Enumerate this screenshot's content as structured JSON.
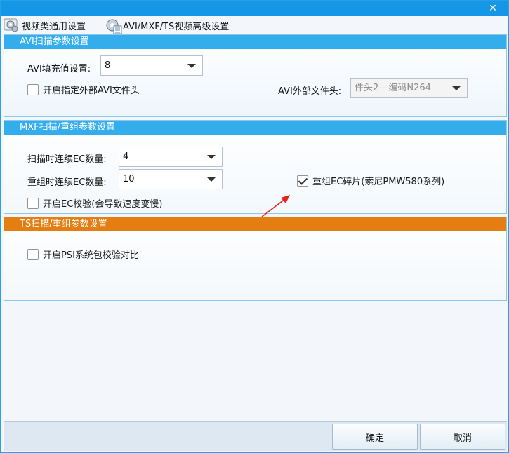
{
  "window": {
    "close_glyph": "✕"
  },
  "tabs": [
    {
      "label": "视频类通用设置",
      "icon": "gear-gray-icon"
    },
    {
      "label": "AVI/MXF/TS视频高级设置",
      "icon": "gear-list-icon"
    }
  ],
  "avi": {
    "header": "AVI扫描参数设置",
    "fill_label": "AVI填充值设置:",
    "fill_value": "8",
    "external_header_check_label": "开启指定外部AVI文件头",
    "external_header_checked": false,
    "external_header_label": "AVI外部文件头:",
    "external_header_value": "件头2---编码N264"
  },
  "mxf": {
    "header": "MXF扫描/重组参数设置",
    "scan_ec_label": "扫描时连续EC数量:",
    "scan_ec_value": "4",
    "rebuild_ec_label": "重组时连续EC数量:",
    "rebuild_ec_value": "10",
    "ec_verify_label": "开启EC校验(会导致速度变慢)",
    "ec_verify_checked": false,
    "ec_fragment_label": "重组EC碎片(索尼PMW580系列)",
    "ec_fragment_checked": true
  },
  "ts": {
    "header": "TS扫描/重组参数设置",
    "psi_label": "开启PSI系统包校验对比",
    "psi_checked": false
  },
  "footer": {
    "ok_label": "确定",
    "cancel_label": "取消"
  },
  "colors": {
    "titlebar": "#1696e6",
    "section_header_blue": "#33adec",
    "section_header_orange": "#e47d12",
    "annotation_arrow": "#e8231a"
  }
}
